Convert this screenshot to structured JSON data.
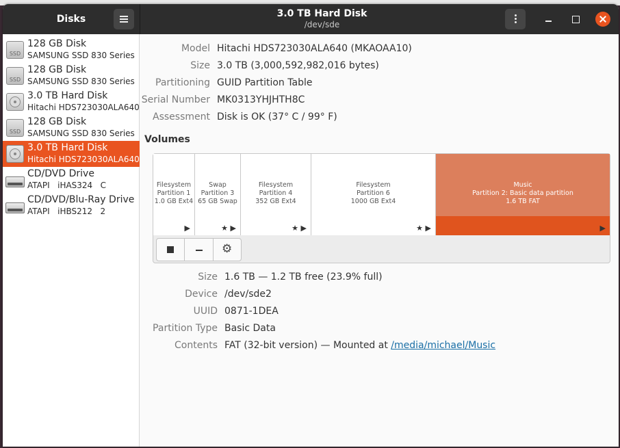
{
  "app": {
    "sidebar_title": "Disks",
    "window_title": "3.0 TB Hard Disk",
    "window_subtitle": "/dev/sde"
  },
  "colors": {
    "accent": "#e95420",
    "headerbar": "#2d2d2d",
    "partition_selected": "#dc7f5c"
  },
  "sidebar": {
    "items": [
      {
        "name": "128 GB Disk",
        "model": "SAMSUNG SSD 830 Series",
        "icon": "ssd-icon"
      },
      {
        "name": "128 GB Disk",
        "model": "SAMSUNG SSD 830 Series",
        "icon": "ssd-icon"
      },
      {
        "name": "3.0 TB Hard Disk",
        "model": "Hitachi HDS723030ALA640",
        "icon": "harddisk-icon"
      },
      {
        "name": "128 GB Disk",
        "model": "SAMSUNG SSD 830 Series",
        "icon": "ssd-icon"
      },
      {
        "name": "3.0 TB Hard Disk",
        "model": "Hitachi HDS723030ALA640",
        "icon": "harddisk-icon",
        "selected": true
      },
      {
        "name": "CD/DVD Drive",
        "model": "ATAPI   iHAS324   C",
        "icon": "optical-drive-icon"
      },
      {
        "name": "CD/DVD/Blu-Ray Drive",
        "model": "ATAPI   iHBS212   2",
        "icon": "optical-drive-icon"
      }
    ]
  },
  "disk": {
    "model_label": "Model",
    "model": "Hitachi HDS723030ALA640 (MKAOAA10)",
    "size_label": "Size",
    "size": "3.0 TB (3,000,592,982,016 bytes)",
    "partitioning_label": "Partitioning",
    "partitioning": "GUID Partition Table",
    "serial_label": "Serial Number",
    "serial": "MK0313YHJHTH8C",
    "assessment_label": "Assessment",
    "assessment": "Disk is OK (37° C / 99° F)"
  },
  "volumes": {
    "heading": "Volumes",
    "partitions": [
      {
        "line1": "Filesystem",
        "line2": "Partition 1",
        "line3": "1.0 GB Ext4",
        "controls": "▶"
      },
      {
        "line1": "Swap",
        "line2": "Partition 3",
        "line3": "65 GB Swap",
        "controls": "★ ▶"
      },
      {
        "line1": "Filesystem",
        "line2": "Partition 4",
        "line3": "352 GB Ext4",
        "controls": "★ ▶"
      },
      {
        "line1": "Filesystem",
        "line2": "Partition 6",
        "line3": "1000 GB Ext4",
        "controls": "★ ▶"
      },
      {
        "line1": "Music",
        "line2": "Partition 2: Basic data partition",
        "line3": "1.6 TB FAT",
        "controls": "▶",
        "selected": true
      }
    ]
  },
  "partition": {
    "size_label": "Size",
    "size": "1.6 TB — 1.2 TB free (23.9% full)",
    "device_label": "Device",
    "device": "/dev/sde2",
    "uuid_label": "UUID",
    "uuid": "0871-1DEA",
    "type_label": "Partition Type",
    "type": "Basic Data",
    "contents_label": "Contents",
    "contents_prefix": "FAT (32-bit version) — Mounted at ",
    "mount_point": "/media/michael/Music"
  }
}
